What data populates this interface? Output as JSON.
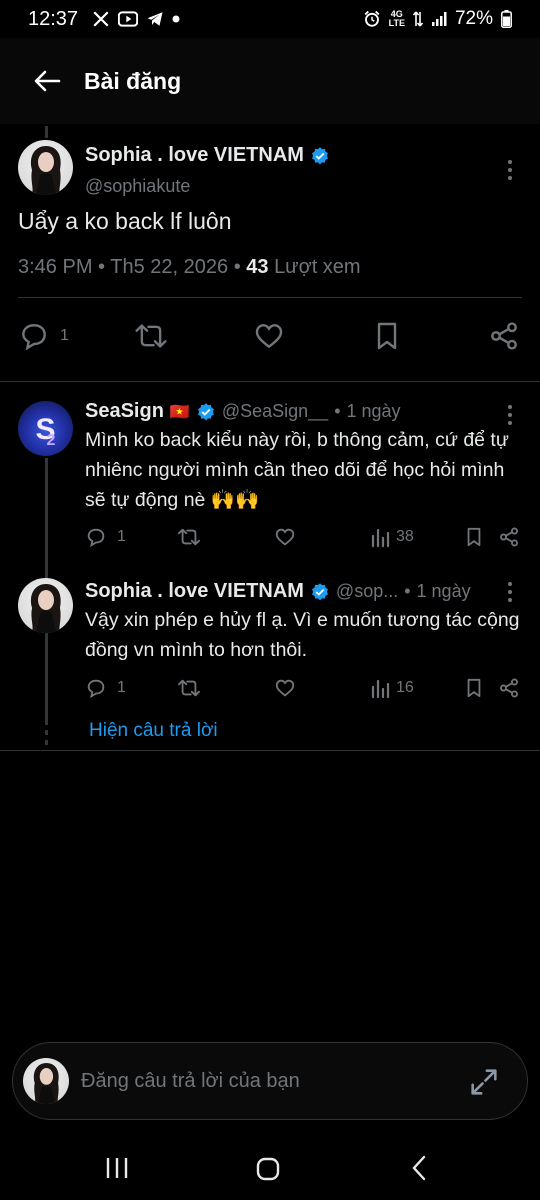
{
  "status_bar": {
    "time": "12:37",
    "network": "4G",
    "network_sub": "LTE",
    "battery": "72%"
  },
  "header": {
    "title": "Bài đăng"
  },
  "main_post": {
    "author": "Sophia . love VIETNAM",
    "handle": "@sophiakute",
    "text": "Uẩy a ko back lf luôn",
    "time": "3:46 PM",
    "date": "Th5 22, 2026",
    "views_count": "43",
    "views_label": "Lượt xem",
    "reply_count": "1"
  },
  "replies": [
    {
      "author": "SeaSign",
      "flag": "🇻🇳",
      "handle": "@SeaSign__",
      "time": "1 ngày",
      "text": "Mình ko back kiểu này rồi, b thông cảm, cứ để tự nhiênc người mình cần theo dõi để học hỏi mình sẽ tự động nè 🙌🙌",
      "reply_count": "1",
      "views": "38"
    },
    {
      "author": "Sophia . love VIETNAM",
      "handle": "@sop...",
      "time": "1 ngày",
      "text": "Vậy xin phép e hủy fl ạ. Vì e muốn tương tác cộng đồng vn mình to hơn thôi.",
      "reply_count": "1",
      "views": "16"
    }
  ],
  "show_replies_label": "Hiện câu trả lời",
  "composer": {
    "placeholder": "Đăng câu trả lời của bạn"
  },
  "colors": {
    "verified": "#1d9bf0",
    "link": "#1d9bf0",
    "muted": "#71767b",
    "background": "#000000"
  }
}
